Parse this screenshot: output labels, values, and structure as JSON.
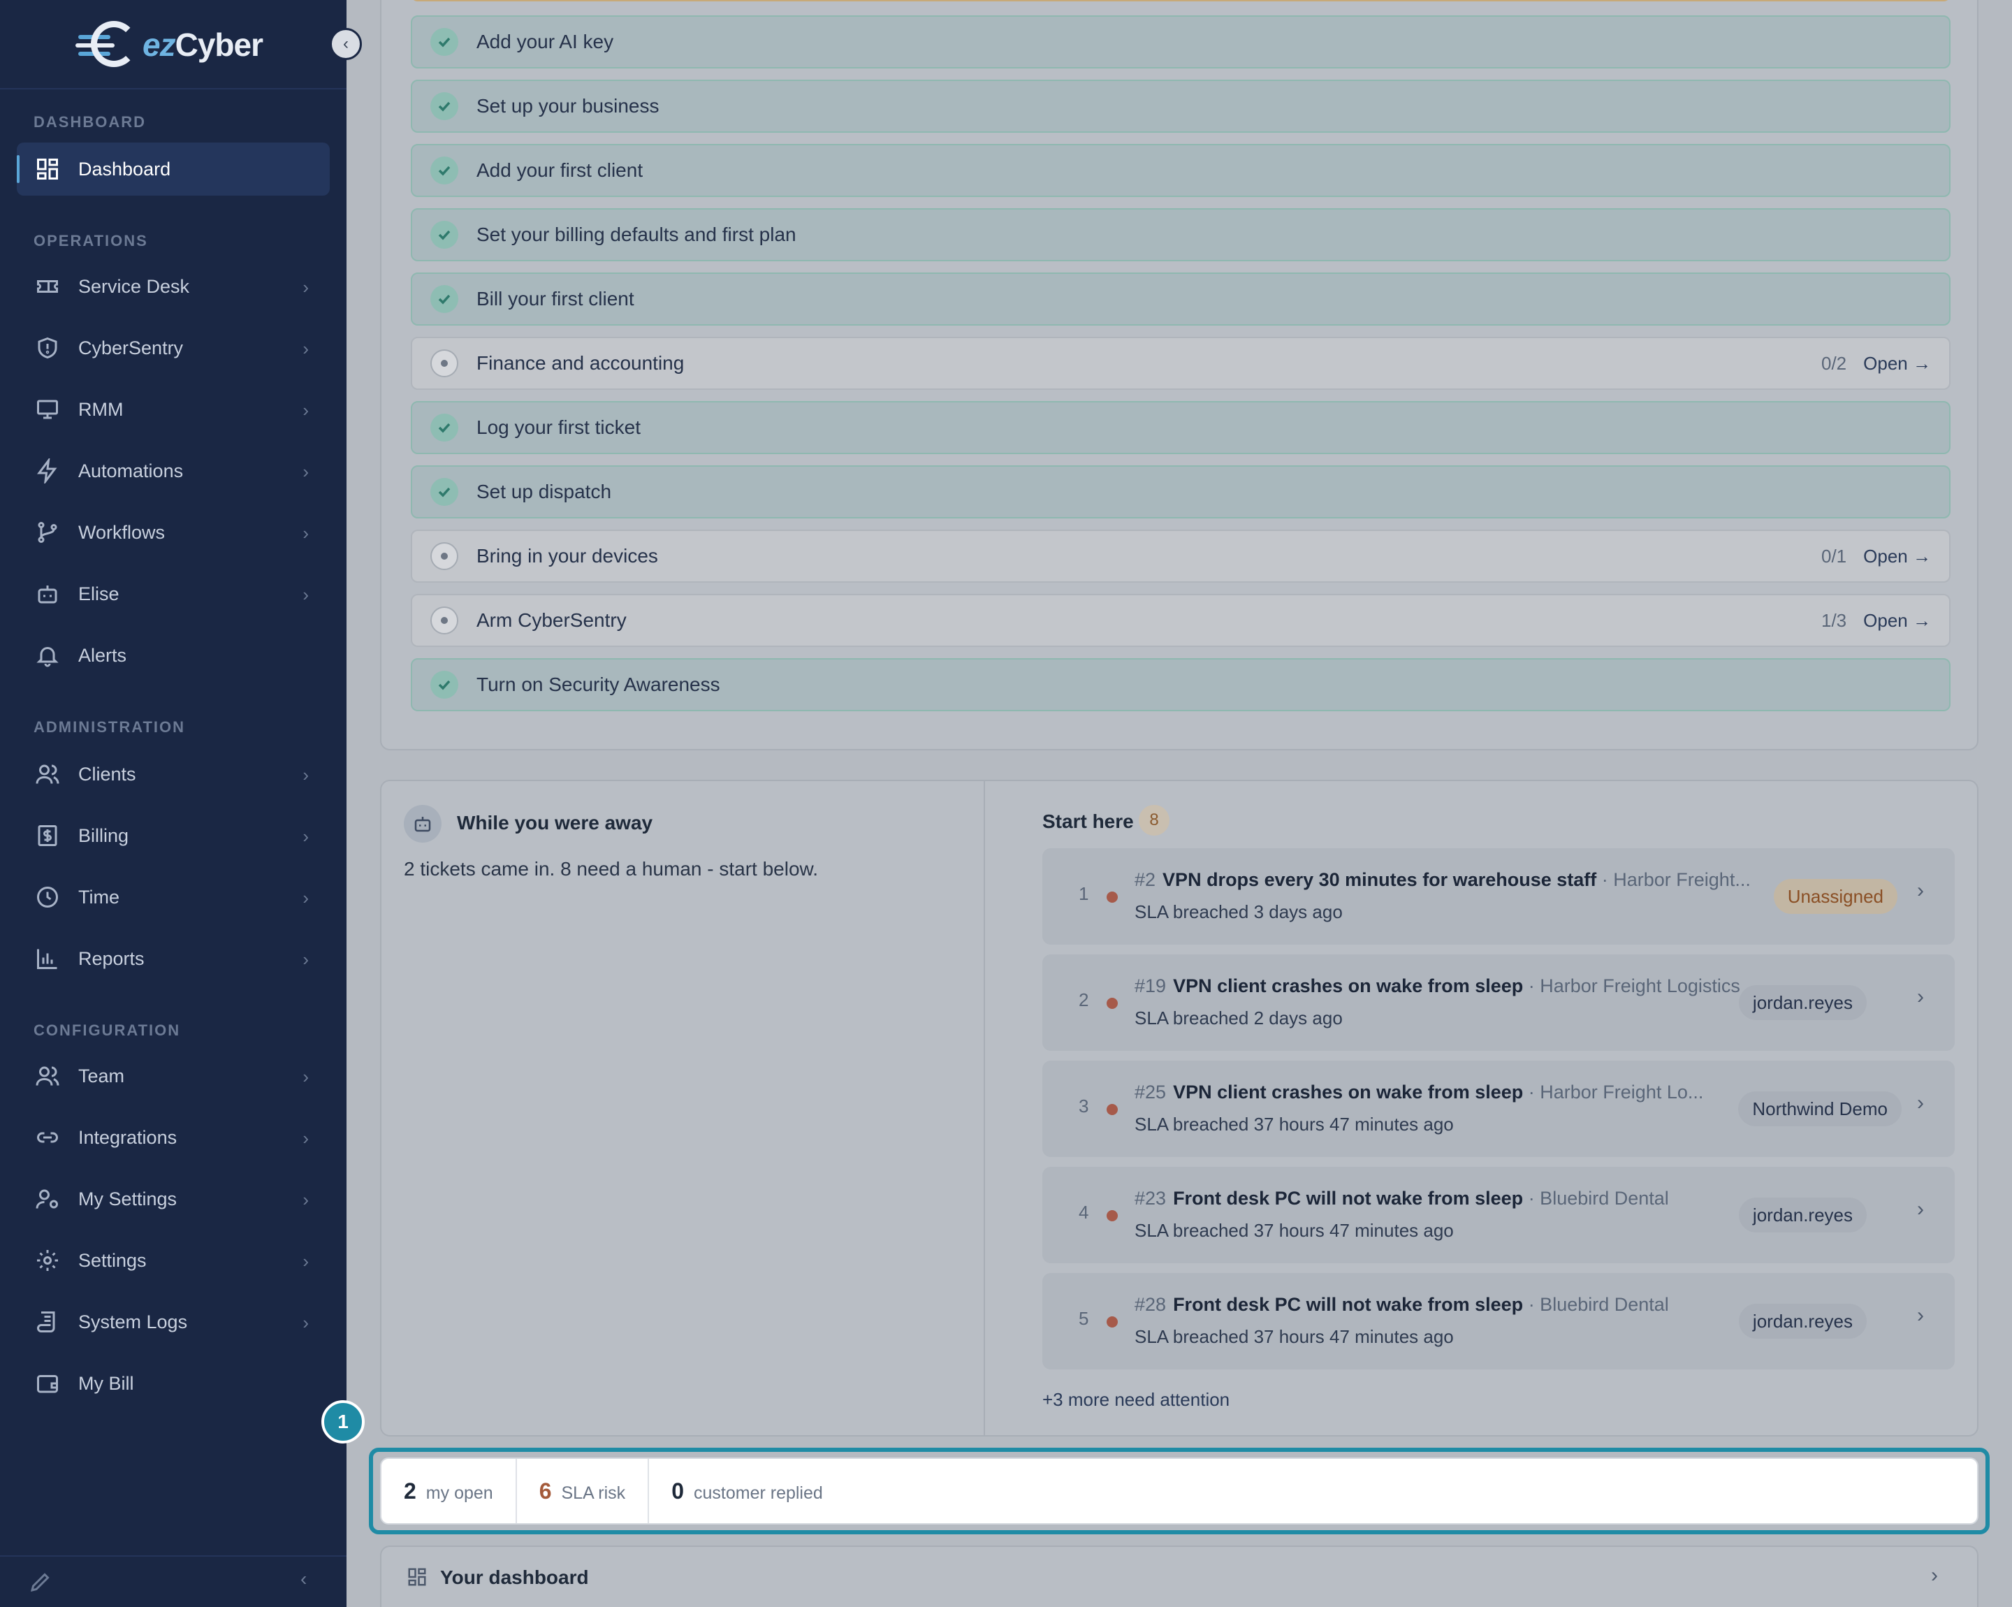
{
  "brand": {
    "logo_prefix": "ez",
    "logo_suffix": "Cyber",
    "collapse_icon": "chevron-left-icon"
  },
  "sidebar": {
    "sections": {
      "dashboard": "DASHBOARD",
      "operations": "OPERATIONS",
      "administration": "ADMINISTRATION",
      "configuration": "CONFIGURATION"
    },
    "items": [
      {
        "label": "Dashboard",
        "icon": "grid-icon",
        "active": true
      },
      {
        "label": "Service Desk",
        "icon": "ticket-icon"
      },
      {
        "label": "CyberSentry",
        "icon": "shield-icon"
      },
      {
        "label": "RMM",
        "icon": "monitor-icon"
      },
      {
        "label": "Automations",
        "icon": "bolt-icon"
      },
      {
        "label": "Workflows",
        "icon": "branch-icon"
      },
      {
        "label": "Elise",
        "icon": "robot-icon"
      },
      {
        "label": "Alerts",
        "icon": "bell-icon"
      },
      {
        "label": "Clients",
        "icon": "users-icon"
      },
      {
        "label": "Billing",
        "icon": "dollar-icon"
      },
      {
        "label": "Time",
        "icon": "clock-icon"
      },
      {
        "label": "Reports",
        "icon": "bar-chart-icon"
      },
      {
        "label": "Team",
        "icon": "team-icon"
      },
      {
        "label": "Integrations",
        "icon": "link-icon"
      },
      {
        "label": "My Settings",
        "icon": "user-gear-icon"
      },
      {
        "label": "Settings",
        "icon": "gear-icon"
      },
      {
        "label": "System Logs",
        "icon": "scroll-icon"
      },
      {
        "label": "My Bill",
        "icon": "wallet-icon"
      }
    ]
  },
  "checklist": [
    {
      "label": "Add your AI key",
      "done": true
    },
    {
      "label": "Set up your business",
      "done": true
    },
    {
      "label": "Add your first client",
      "done": true
    },
    {
      "label": "Set your billing defaults and first plan",
      "done": true
    },
    {
      "label": "Bill your first client",
      "done": true
    },
    {
      "label": "Finance and accounting",
      "done": false,
      "count": "0/2",
      "action": "Open"
    },
    {
      "label": "Log your first ticket",
      "done": true
    },
    {
      "label": "Set up dispatch",
      "done": true
    },
    {
      "label": "Bring in your devices",
      "done": false,
      "count": "0/1",
      "action": "Open"
    },
    {
      "label": "Arm CyberSentry",
      "done": false,
      "count": "1/3",
      "action": "Open"
    },
    {
      "label": "Turn on Security Awareness",
      "done": true
    }
  ],
  "away": {
    "title": "While you were away",
    "summary": "2 tickets came in. 8 need a human - start below."
  },
  "start_here": {
    "title": "Start here",
    "count": "8",
    "tickets": [
      {
        "rank": "1",
        "id": "#2",
        "title": "VPN drops every 30 minutes for warehouse staff",
        "client": "· Harbor Freight...",
        "sla": "SLA breached 3 days ago",
        "assignee": "Unassigned",
        "unassigned": true
      },
      {
        "rank": "2",
        "id": "#19",
        "title": "VPN client crashes on wake from sleep",
        "client": "· Harbor Freight Logistics",
        "sla": "SLA breached 2 days ago",
        "assignee": "jordan.reyes"
      },
      {
        "rank": "3",
        "id": "#25",
        "title": "VPN client crashes on wake from sleep",
        "client": "· Harbor Freight Lo...",
        "sla": "SLA breached 37 hours 47 minutes ago",
        "assignee": "Northwind Demo"
      },
      {
        "rank": "4",
        "id": "#23",
        "title": "Front desk PC will not wake from sleep",
        "client": "· Bluebird Dental",
        "sla": "SLA breached 37 hours 47 minutes ago",
        "assignee": "jordan.reyes"
      },
      {
        "rank": "5",
        "id": "#28",
        "title": "Front desk PC will not wake from sleep",
        "client": "· Bluebird Dental",
        "sla": "SLA breached 37 hours 47 minutes ago",
        "assignee": "jordan.reyes"
      }
    ],
    "more": "+3 more need attention"
  },
  "stats": [
    {
      "value": "2",
      "label": "my open"
    },
    {
      "value": "6",
      "label": "SLA risk",
      "warn": true
    },
    {
      "value": "0",
      "label": "customer replied"
    }
  ],
  "step_marker": "1",
  "dashboard_card": {
    "title": "Your dashboard"
  }
}
